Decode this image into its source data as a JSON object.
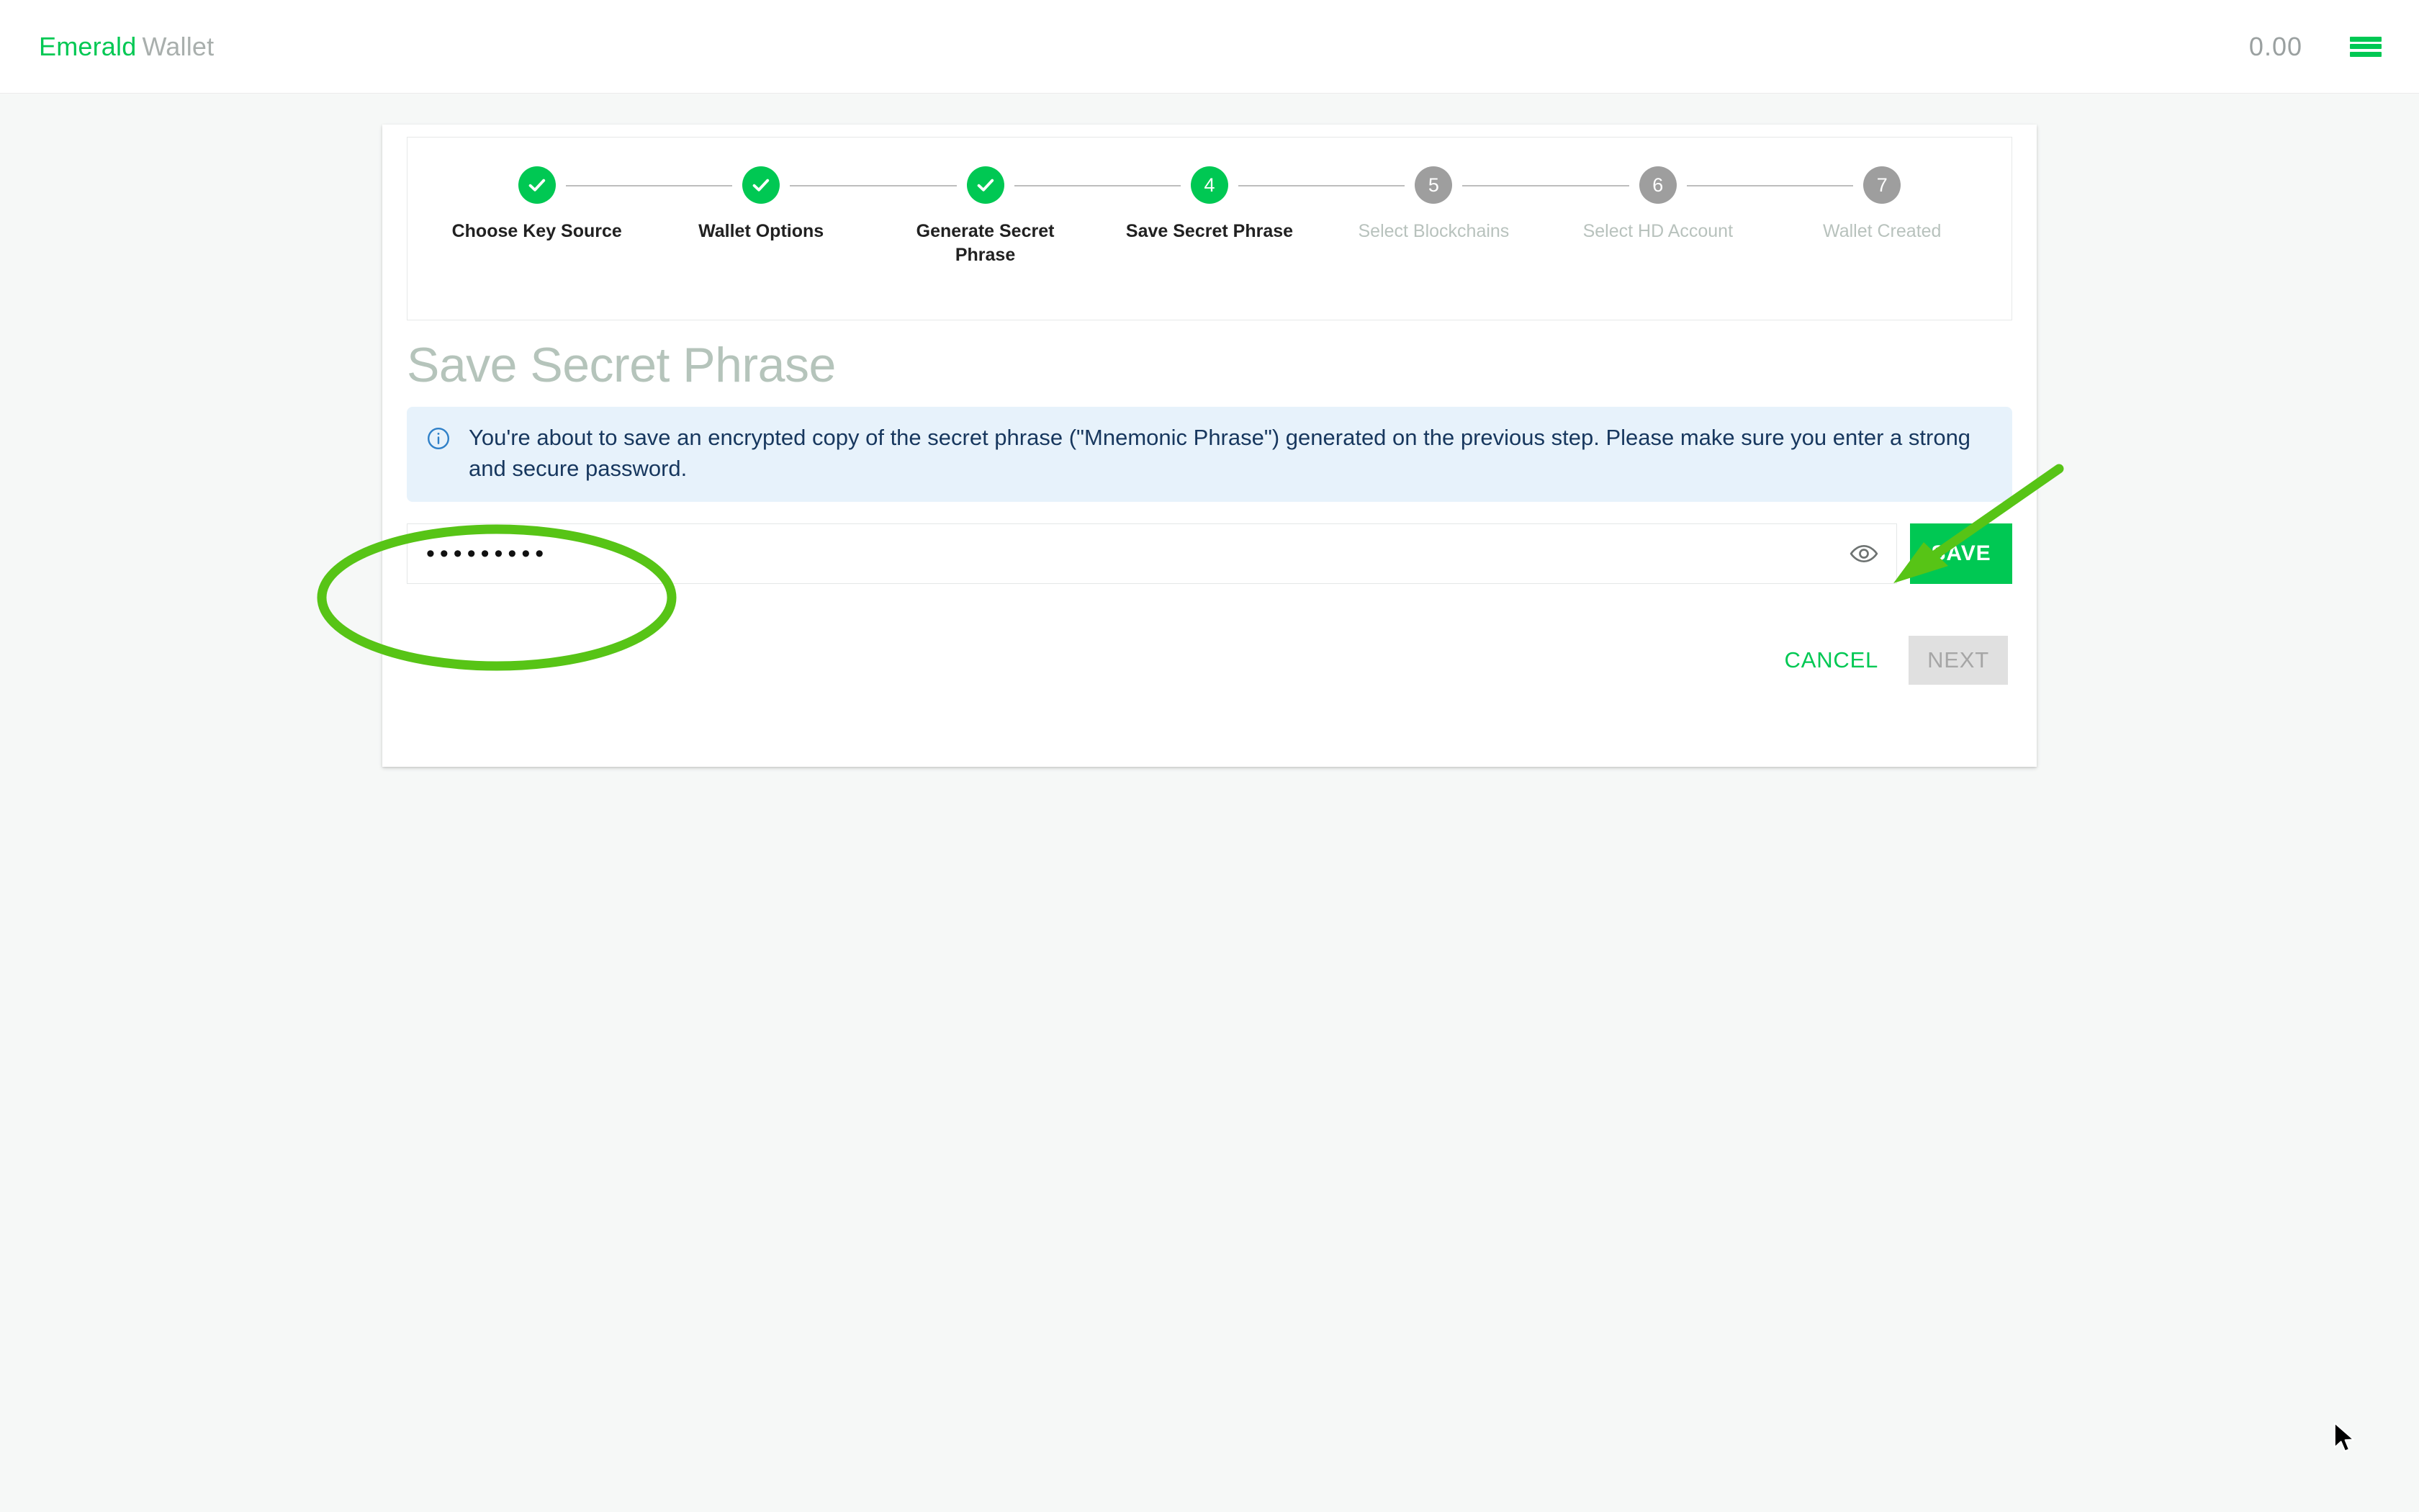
{
  "header": {
    "brand_primary": "Emerald",
    "brand_secondary": "Wallet",
    "balance": "0.00",
    "menu_icon": "hamburger-menu-icon"
  },
  "stepper": {
    "steps": [
      {
        "number": "1",
        "label": "Choose Key Source",
        "state": "done"
      },
      {
        "number": "2",
        "label": "Wallet Options",
        "state": "done"
      },
      {
        "number": "3",
        "label": "Generate Secret Phrase",
        "state": "done"
      },
      {
        "number": "4",
        "label": "Save Secret Phrase",
        "state": "active"
      },
      {
        "number": "5",
        "label": "Select Blockchains",
        "state": "todo"
      },
      {
        "number": "6",
        "label": "Select HD Account",
        "state": "todo"
      },
      {
        "number": "7",
        "label": "Wallet Created",
        "state": "todo"
      }
    ]
  },
  "main": {
    "title": "Save Secret Phrase",
    "info": {
      "icon": "info-circle-icon",
      "text": "You're about to save an encrypted copy of the secret phrase (\"Mnemonic Phrase\") generated on the previous step. Please make sure you enter a strong and secure password."
    },
    "password": {
      "value": "•••••••••",
      "placeholder": "",
      "toggle_icon": "eye-icon"
    },
    "save_label": "SAVE",
    "cancel_label": "CANCEL",
    "next_label": "NEXT"
  },
  "colors": {
    "brand_green": "#00c853",
    "annotation_green": "#57c416",
    "info_bg": "#e7f2fb",
    "info_text": "#17375e",
    "title_gray": "#b5c4bb",
    "step_todo_gray": "#9e9e9e",
    "disabled_gray": "#e0e0e0"
  }
}
